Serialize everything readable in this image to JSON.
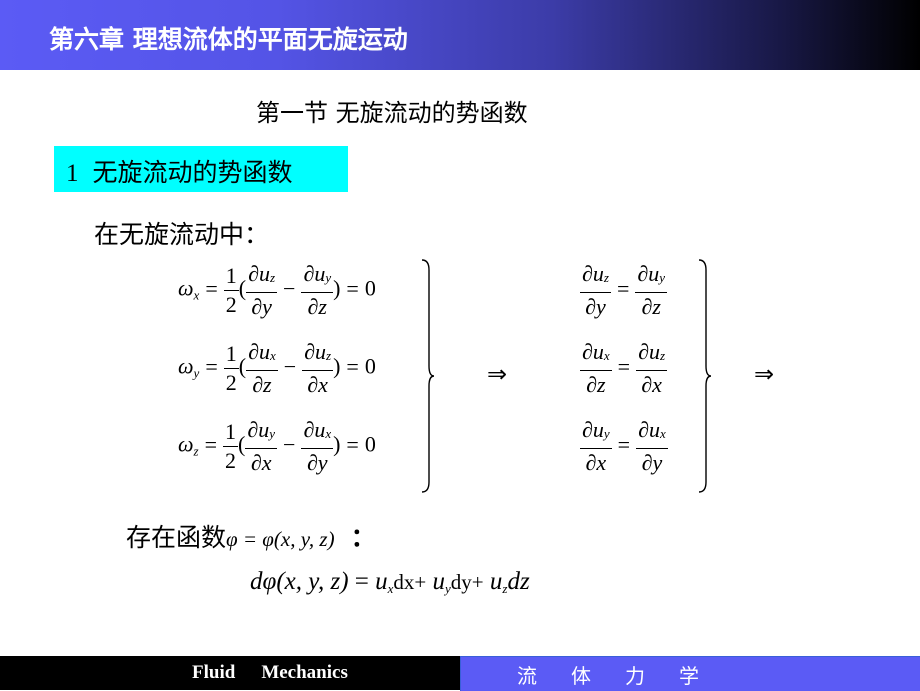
{
  "header": {
    "title": "第六章  理想流体的平面无旋运动"
  },
  "section": {
    "title": "第一节  无旋流动的势函数"
  },
  "subsection": {
    "number": "1",
    "title": "无旋流动的势函数"
  },
  "intro_text": "在无旋流动中：",
  "rotation_equations": [
    {
      "lhs": "ω",
      "lhs_sub": "x",
      "coef_num": "1",
      "coef_den": "2",
      "t1_num_var": "u",
      "t1_num_sub": "z",
      "t1_den": "∂y",
      "t2_num_var": "u",
      "t2_num_sub": "y",
      "t2_den": "∂z",
      "rhs": "0"
    },
    {
      "lhs": "ω",
      "lhs_sub": "y",
      "coef_num": "1",
      "coef_den": "2",
      "t1_num_var": "u",
      "t1_num_sub": "x",
      "t1_den": "∂z",
      "t2_num_var": "u",
      "t2_num_sub": "z",
      "t2_den": "∂x",
      "rhs": "0"
    },
    {
      "lhs": "ω",
      "lhs_sub": "z",
      "coef_num": "1",
      "coef_den": "2",
      "t1_num_var": "u",
      "t1_num_sub": "y",
      "t1_den": "∂x",
      "t2_num_var": "u",
      "t2_num_sub": "x",
      "t2_den": "∂y",
      "rhs": "0"
    }
  ],
  "equality_equations": [
    {
      "l_sub": "z",
      "l_den": "∂y",
      "r_sub": "y",
      "r_den": "∂z"
    },
    {
      "l_sub": "x",
      "l_den": "∂z",
      "r_sub": "z",
      "r_den": "∂x"
    },
    {
      "l_sub": "y",
      "l_den": "∂x",
      "r_sub": "x",
      "r_den": "∂y"
    }
  ],
  "symbols": {
    "partial": "∂",
    "implies": "⇒",
    "equals": "=",
    "minus": "−",
    "lparen": "(",
    "rparen": ")"
  },
  "existence": {
    "label": "存在函数",
    "function": "φ = φ(x, y, z)",
    "colon": "："
  },
  "differential": {
    "lhs": "dφ(x, y, z)",
    "equals": " = ",
    "term1_var": "u",
    "term1_sub": "x",
    "term1_d": "dx+",
    "term2_var": "u",
    "term2_sub": "y",
    "term2_d": "dy+",
    "term3_var": "u",
    "term3_sub": "z",
    "term3_d": "dz"
  },
  "footer": {
    "en_word1": "Fluid",
    "en_word2": "Mechanics",
    "zh": "流体力学"
  },
  "colors": {
    "header_start": "#5b5bf5",
    "header_end": "#000000",
    "highlight": "#00ffff",
    "footer_left": "#000000",
    "footer_right": "#5b5bf5"
  }
}
